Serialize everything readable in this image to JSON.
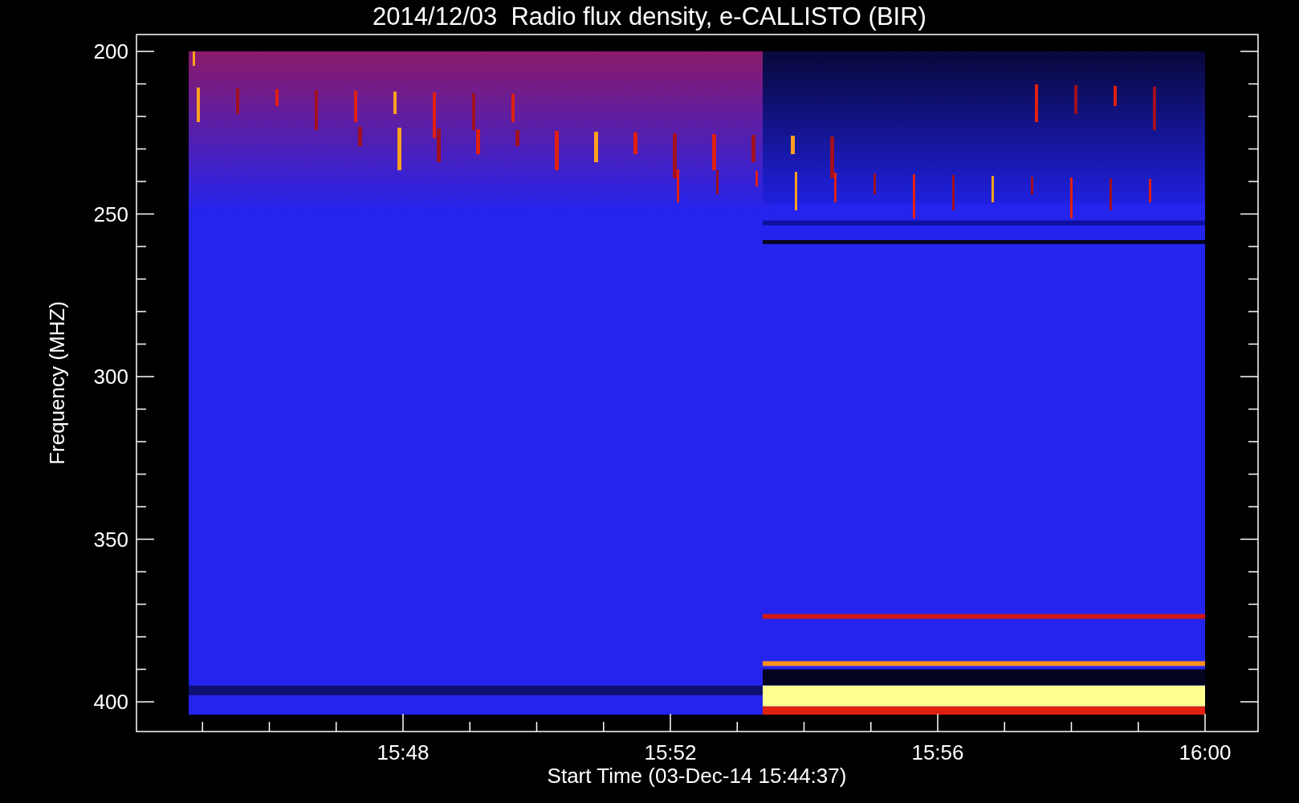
{
  "title": "2014/12/03  Radio flux density, e-CALLISTO (BIR)",
  "y_axis": {
    "label": "Frequency (MHZ)",
    "ticks": [
      "200",
      "250",
      "300",
      "350",
      "400"
    ]
  },
  "x_axis": {
    "label": "Start Time (03-Dec-14 15:44:37)",
    "ticks": [
      "15:48",
      "15:52",
      "15:56",
      "16:00"
    ]
  }
}
